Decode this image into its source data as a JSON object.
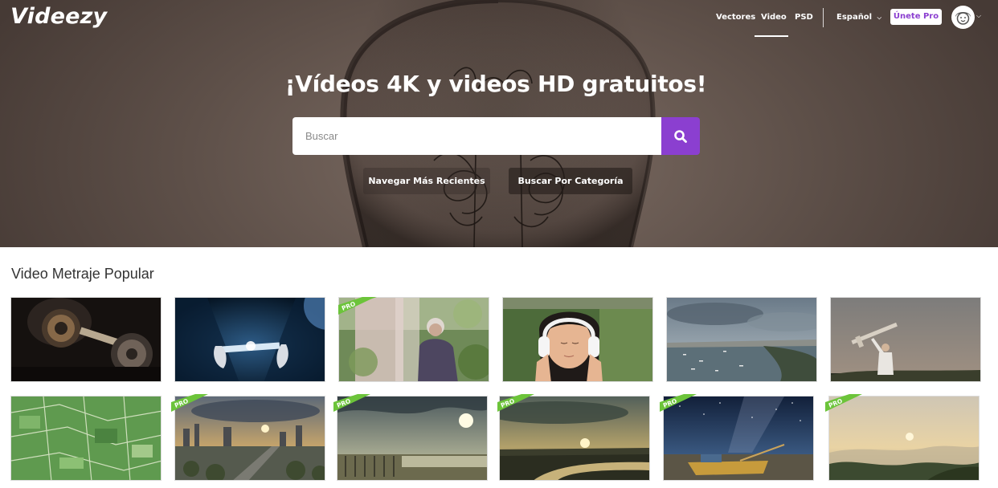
{
  "brand": {
    "logo_text": "Videezy",
    "accent_color": "#8b3fd0",
    "pro_ribbon_color": "#6cc43a"
  },
  "nav": {
    "items": [
      {
        "label": "Vectores",
        "active": false
      },
      {
        "label": "Video",
        "active": true
      },
      {
        "label": "PSD",
        "active": false
      }
    ],
    "language": "Español",
    "pro_button": "Únete Pro",
    "avatar_icon": "avatar-icon"
  },
  "hero": {
    "title": "¡Vídeos 4K y videos HD gratuitos!",
    "search": {
      "placeholder": "Buscar",
      "value": "",
      "icon": "search-icon"
    },
    "buttons": [
      "Navegar Más Recientes",
      "Buscar Por Categoría"
    ]
  },
  "popular": {
    "title": "Video Metraje Popular",
    "pro_label": "PRO",
    "thumbnails": [
      {
        "subject": "metal dumbbells on dark table",
        "pro": false
      },
      {
        "subject": "hands holding glowing tablet",
        "pro": false
      },
      {
        "subject": "elderly woman among plants",
        "pro": true
      },
      {
        "subject": "girl with headphones",
        "pro": false
      },
      {
        "subject": "coastal city bay under clouds",
        "pro": false
      },
      {
        "subject": "man with toy airplane at dusk",
        "pro": false
      },
      {
        "subject": "aerial green farm fields",
        "pro": false
      },
      {
        "subject": "city skyline at sunset",
        "pro": true
      },
      {
        "subject": "sunset over wetland fence",
        "pro": true
      },
      {
        "subject": "river bend at sunset",
        "pro": true
      },
      {
        "subject": "boat under starry sky",
        "pro": true
      },
      {
        "subject": "misty valley at sunrise",
        "pro": true
      }
    ]
  }
}
